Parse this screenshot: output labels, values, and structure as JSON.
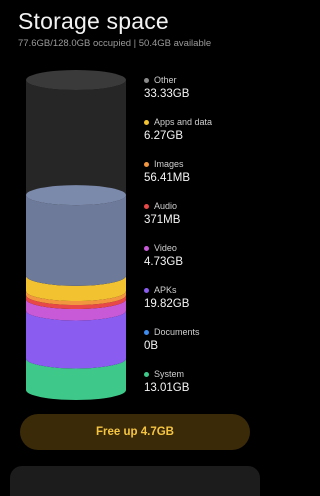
{
  "header": {
    "title": "Storage space",
    "subtitle": "77.6GB/128.0GB occupied | 50.4GB available"
  },
  "legend": [
    {
      "label": "Other",
      "value": "33.33GB",
      "color": "#8a8a8a"
    },
    {
      "label": "Apps and data",
      "value": "6.27GB",
      "color": "#f2c230"
    },
    {
      "label": "Images",
      "value": "56.41MB",
      "color": "#f29640"
    },
    {
      "label": "Audio",
      "value": "371MB",
      "color": "#e84848"
    },
    {
      "label": "Video",
      "value": "4.73GB",
      "color": "#c85ad8"
    },
    {
      "label": "APKs",
      "value": "19.82GB",
      "color": "#8a5cf0"
    },
    {
      "label": "Documents",
      "value": "0B",
      "color": "#3d8cf0"
    },
    {
      "label": "System",
      "value": "13.01GB",
      "color": "#3ec98a"
    }
  ],
  "chart_data": {
    "type": "bar",
    "categories": [
      "Other",
      "Apps and data",
      "Images",
      "Audio",
      "Video",
      "APKs",
      "Documents",
      "System"
    ],
    "values": [
      33.33,
      6.27,
      0.05641,
      0.371,
      4.73,
      19.82,
      0,
      13.01
    ],
    "units": "GB",
    "total_gb": 128.0,
    "used_gb": 77.6
  },
  "action": {
    "free_up_label": "Free up 4.7GB"
  },
  "colors": {
    "empty_top": "#3a3a3a",
    "empty_body": "#262626",
    "other": "#6e7a99",
    "button_bg": "#3a2a08",
    "button_text": "#f5c542"
  }
}
